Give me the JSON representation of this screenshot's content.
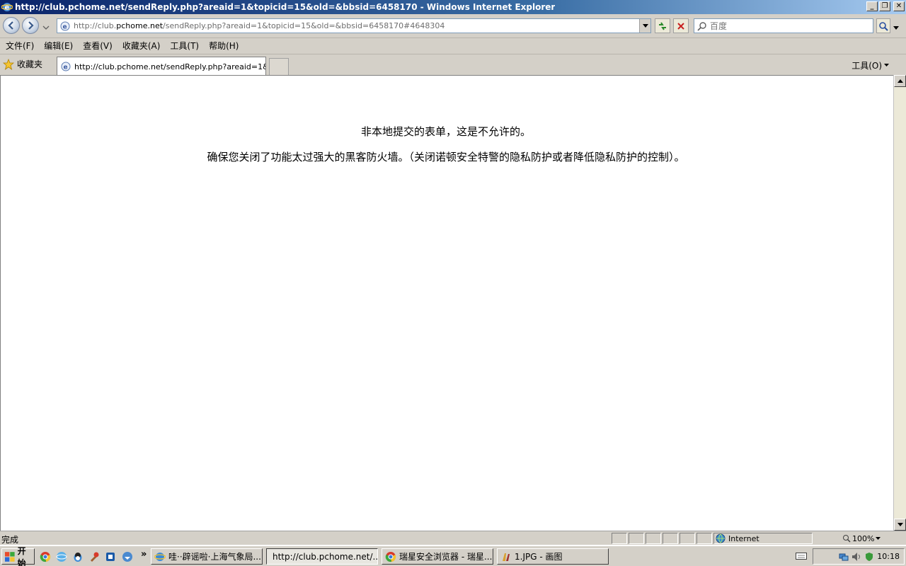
{
  "window": {
    "title": "http://club.pchome.net/sendReply.php?areaid=1&topicid=15&old=&bbsid=6458170 - Windows Internet Explorer"
  },
  "address": {
    "prefix": "http://club.",
    "domain": "pchome.net",
    "suffix": "/sendReply.php?areaid=1&topicid=15&old=&bbsid=6458170#4648304"
  },
  "search": {
    "placeholder": "百度"
  },
  "menu": [
    "文件(F)",
    "编辑(E)",
    "查看(V)",
    "收藏夹(A)",
    "工具(T)",
    "帮助(H)"
  ],
  "favorites_label": "收藏夹",
  "tab": {
    "title": "http://club.pchome.net/sendReply.php?areaid=1&to..."
  },
  "tools_label": "工具(O)",
  "content": {
    "line1": "非本地提交的表单，这是不允许的。",
    "line2": "确保您关闭了功能太过强大的黑客防火墙。（关闭诺顿安全特警的隐私防护或者降低隐私防护的控制）。"
  },
  "status": {
    "text": "完成",
    "zone": "Internet",
    "zoom": "100%"
  },
  "taskbar": {
    "start": "开始",
    "buttons": [
      "哇··辟谣啦·上海气象局...",
      "http://club.pchome.net/...",
      "瑞星安全浏览器 - 瑞星...",
      "1.JPG - 画图"
    ],
    "clock": "10:18"
  }
}
